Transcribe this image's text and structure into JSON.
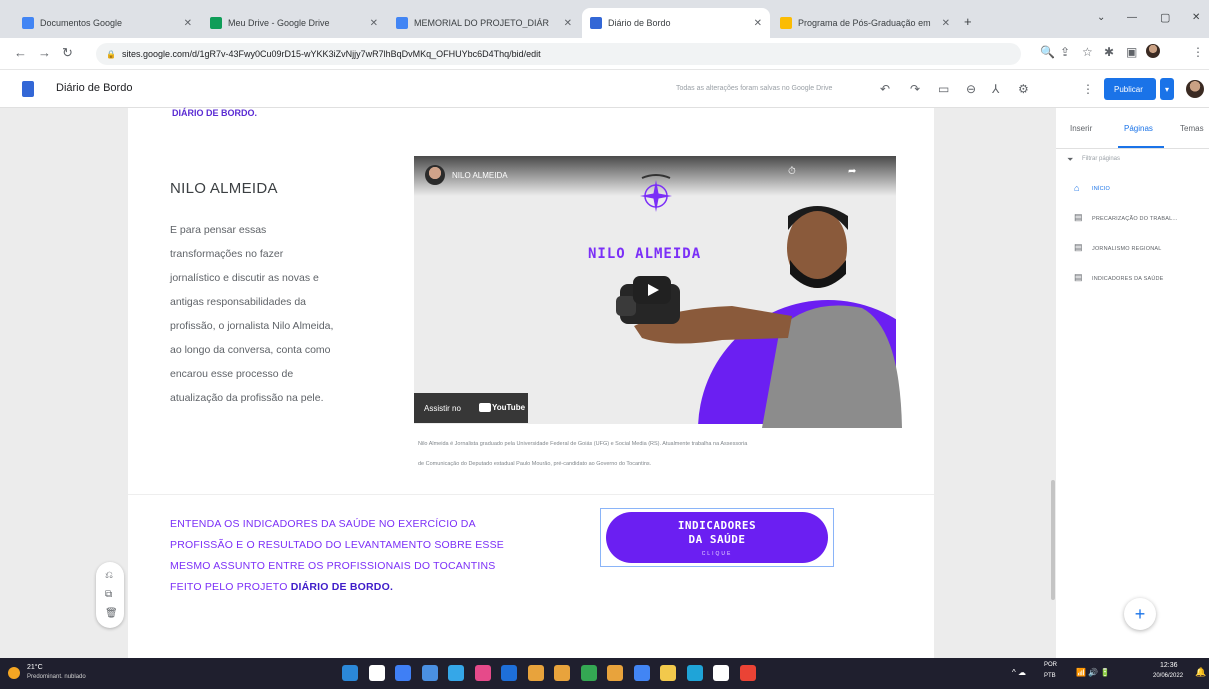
{
  "browser": {
    "tabs": [
      {
        "title": "Documentos Google",
        "color": "#4285f4"
      },
      {
        "title": "Meu Drive - Google Drive",
        "color": "#0f9d58"
      },
      {
        "title": "MEMORIAL DO PROJETO_DIÁR",
        "color": "#4285f4"
      },
      {
        "title": "Diário de Bordo",
        "color": "#3367d6"
      },
      {
        "title": "Programa de Pós-Graduação em",
        "color": "#fbbc04"
      }
    ],
    "new_tab": "+",
    "window_controls": {
      "minimize": "—",
      "maximize": "▢",
      "close": "✕",
      "dropdown": "⌄"
    },
    "nav": {
      "back": "←",
      "forward": "→",
      "reload": "↻"
    },
    "url": "sites.google.com/d/1gR7v-43Fwy0Cu09rD15-wYKK3iZvNjjy7wR7lhBqDvMKq_OFHUYbc6D4Thq/bid/edit",
    "right_icons": [
      "🔍",
      "⇪",
      "☆",
      "✱",
      "▣",
      "⋮"
    ]
  },
  "sites": {
    "title": "Diário de Bordo",
    "save_status": "Todas as alterações foram salvas no Google Drive",
    "toolbar_icons": [
      "↶",
      "↷",
      "▭",
      "⊖",
      "⅄",
      "⚙",
      "⋮"
    ],
    "publish": "Publicar",
    "publish_arrow": "▾"
  },
  "content": {
    "top_link": "DIÁRIO DE BORDO.",
    "section_title": "NILO ALMEIDA",
    "paragraph_lines": [
      "E para pensar essas",
      "transformações no fazer",
      "jornalístico e discutir as novas e",
      "antigas responsabilidades da",
      "profissão, o jornalista Nilo Almeida,",
      "ao longo da conversa, conta como",
      "encarou esse processo de",
      "atualização da profissão na pele."
    ],
    "video": {
      "channel": "NILO ALMEIDA",
      "overlay_name": "NILO ALMEIDA",
      "watch_on": "Assistir no",
      "youtube": "YouTube",
      "clock_icon": "⏱",
      "share_icon": "➦"
    },
    "caption_lines": [
      "Nilo Almeida é Jornalista graduado pela Universidade Federal de Goiás (UFG) e Social Media (RS). Atualmente trabalha na Assessoria",
      "de Comunicação do Deputado estadual Paulo Mourão, pré-candidato ao Governo do Tocantins."
    ],
    "cta_lines": [
      "ENTENDA OS INDICADORES DA SAÚDE NO  EXERCÍCIO DA",
      "PROFISSÃO E O RESULTADO DO LEVANTAMENTO SOBRE ESSE",
      "MESMO ASSUNTO ENTRE OS PROFISSIONAIS DO TOCANTINS",
      "FEITO PELO PROJETO"
    ],
    "cta_bold": "DIÁRIO DE BORDO.",
    "cta_button": {
      "line1": "INDICADORES",
      "line2": "DA SAÚDE",
      "line3": "CLIQUE"
    }
  },
  "float_tools": [
    "⎌",
    "⧉",
    "🗑"
  ],
  "panel": {
    "tabs": [
      "Inserir",
      "Páginas",
      "Temas"
    ],
    "active_tab": "Páginas",
    "filter_placeholder": "Filtrar páginas",
    "filter_icon": "⏷",
    "pages": [
      {
        "icon": "⌂",
        "label": "INÍCIO"
      },
      {
        "icon": "▤",
        "label": "PRECARIZAÇÃO DO TRABAL..."
      },
      {
        "icon": "▤",
        "label": "JORNALISMO REGIONAL"
      },
      {
        "icon": "▤",
        "label": "INDICADORES DA SAÚDE"
      }
    ],
    "fab": "+"
  },
  "taskbar": {
    "weather_temp": "21°C",
    "weather_cond": "Predominant. nublado",
    "apps": [
      "#2b88d8",
      "#ffffff",
      "#3f7ff5",
      "#4a90e2",
      "#35a7e8",
      "#e64a8a",
      "#1e6fd9",
      "#e8a33c",
      "#e8a33c",
      "#34a853",
      "#e8a33c",
      "#4285f4",
      "#f2c94c",
      "#1fa4d8",
      "#ffffff",
      "#ea4335"
    ],
    "tray": "^ ☁",
    "lang1": "POR",
    "lang2": "PTB",
    "tray_icons": "📶 🔊 🔋",
    "time": "12:36",
    "date": "20/06/2022",
    "notif": "🔔"
  }
}
